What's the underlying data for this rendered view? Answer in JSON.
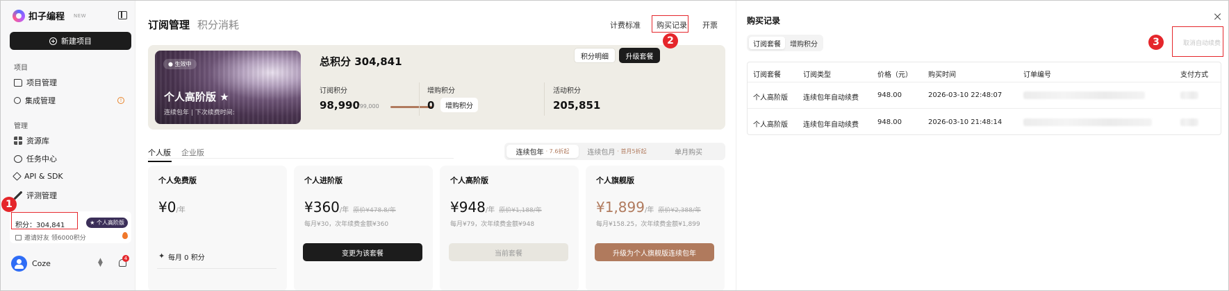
{
  "sidebar": {
    "logo_text": "扣子编程",
    "logo_badge": "NEW",
    "new_project_label": "新建项目",
    "section_project": "项目",
    "section_manage": "管理",
    "items": [
      {
        "label": "项目管理",
        "icon": "folder-icon"
      },
      {
        "label": "集成管理",
        "icon": "plug-icon"
      },
      {
        "label": "资源库",
        "icon": "grid-icon"
      },
      {
        "label": "任务中心",
        "icon": "clock-icon"
      },
      {
        "label": "API & SDK",
        "icon": "api-icon"
      },
      {
        "label": "评测管理",
        "icon": "eval-icon"
      }
    ],
    "warning_glyph": "!",
    "points_text": "积分：304,841",
    "level_badge": "★ 个人高阶版",
    "invite_text": "邀请好友 领6000积分",
    "user_name": "Coze",
    "notification_count": "4"
  },
  "annotations": {
    "badge1": "1",
    "badge2": "2",
    "badge3": "3",
    "color": "#e5262b"
  },
  "main": {
    "title": "订阅管理",
    "title_alt": "积分消耗",
    "links": {
      "pricing": "计费标准",
      "purchase": "购买记录",
      "invoice": "开票"
    },
    "hero": {
      "active_label": "● 生效中",
      "plan_name": "个人高阶版 ★",
      "plan_sub": "连续包年  |  下次续费时间:",
      "total_label": "总积分  304,841",
      "detail_btn": "积分明细",
      "upgrade_btn": "升级套餐",
      "sub_label": "订阅积分",
      "sub_value": "98,990",
      "sub_total": "/99,000",
      "sub_progress": 0.9999,
      "buy_label": "增购积分",
      "buy_value": "0",
      "buy_btn": "增购积分",
      "activity_label": "活动积分",
      "activity_value": "205,851"
    },
    "edition_tabs": [
      "个人版",
      "企业版"
    ],
    "billing": [
      {
        "label": "连续包年",
        "discount": "· 7.6折起"
      },
      {
        "label": "连续包月",
        "discount": "· 首月5折起"
      },
      {
        "label": "单月购买",
        "discount": ""
      }
    ],
    "plans": [
      {
        "name": "个人免费版",
        "price": "¥0",
        "unit": "/年",
        "orig": "",
        "note": "",
        "button": "",
        "feature": "每月 0 积分"
      },
      {
        "name": "个人进阶版",
        "price": "¥360",
        "unit": "/年",
        "orig": "原价¥478.8/年",
        "note": "每月¥30，次年续费金额¥360",
        "button": "变更为该套餐"
      },
      {
        "name": "个人高阶版",
        "price": "¥948",
        "unit": "/年",
        "orig": "原价¥1,188/年",
        "note": "每月¥79，次年续费金额¥948",
        "button": "当前套餐"
      },
      {
        "name": "个人旗舰版",
        "price": "¥1,899",
        "unit": "/年",
        "orig": "原价¥2,388/年",
        "note": "每月¥158.25，次年续费金额¥1,899",
        "button": "升级为个人旗舰版连续包年"
      }
    ],
    "accent": "#b07a5d"
  },
  "drawer": {
    "title": "购买记录",
    "tabs": [
      "订阅套餐",
      "增购积分"
    ],
    "cancel_label": "取消自动续费",
    "columns": [
      "订阅套餐",
      "订阅类型",
      "价格（元）",
      "购买时间",
      "订单编号",
      "支付方式"
    ],
    "rows": [
      [
        "个人高阶版",
        "连续包年自动续费",
        "948.00",
        "2026-03-10 22:48:07"
      ],
      [
        "个人高阶版",
        "连续包年自动续费",
        "948.00",
        "2026-03-10 21:48:14"
      ]
    ]
  }
}
